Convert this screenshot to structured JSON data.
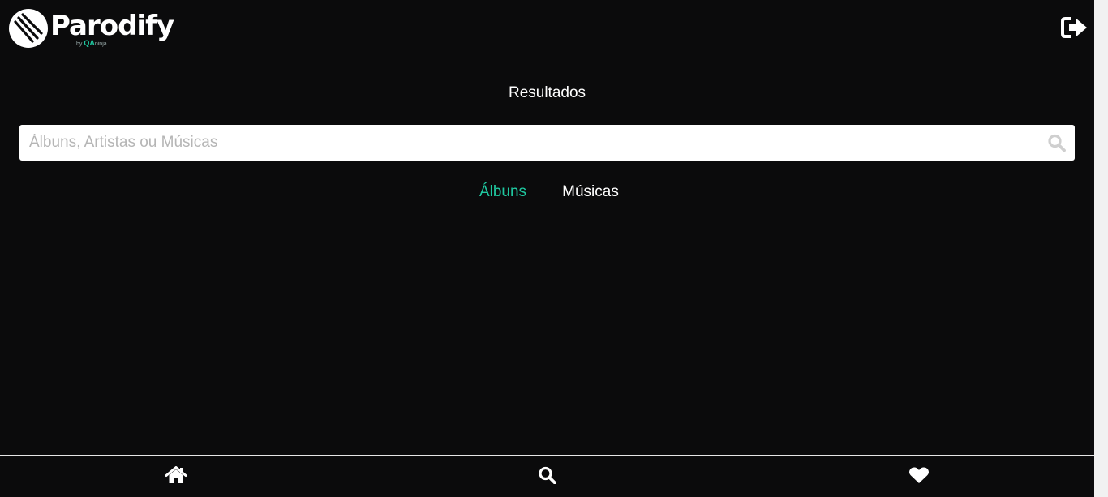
{
  "header": {
    "brand": "Parodify",
    "brand_by": "by",
    "brand_partner": "QA",
    "brand_partner_rest": "ninja",
    "logout_icon": "sign-out-icon"
  },
  "page": {
    "title": "Resultados"
  },
  "search": {
    "placeholder": "Álbuns, Artistas ou Músicas",
    "value": "",
    "icon": "search-icon"
  },
  "tabs": [
    {
      "label": "Álbuns",
      "active": true
    },
    {
      "label": "Músicas",
      "active": false
    }
  ],
  "bottom_nav": [
    {
      "icon": "home-icon"
    },
    {
      "icon": "search-icon"
    },
    {
      "icon": "heart-icon"
    }
  ],
  "colors": {
    "background": "#0b0b0c",
    "accent": "#1fc8a0",
    "text": "#ffffff"
  }
}
